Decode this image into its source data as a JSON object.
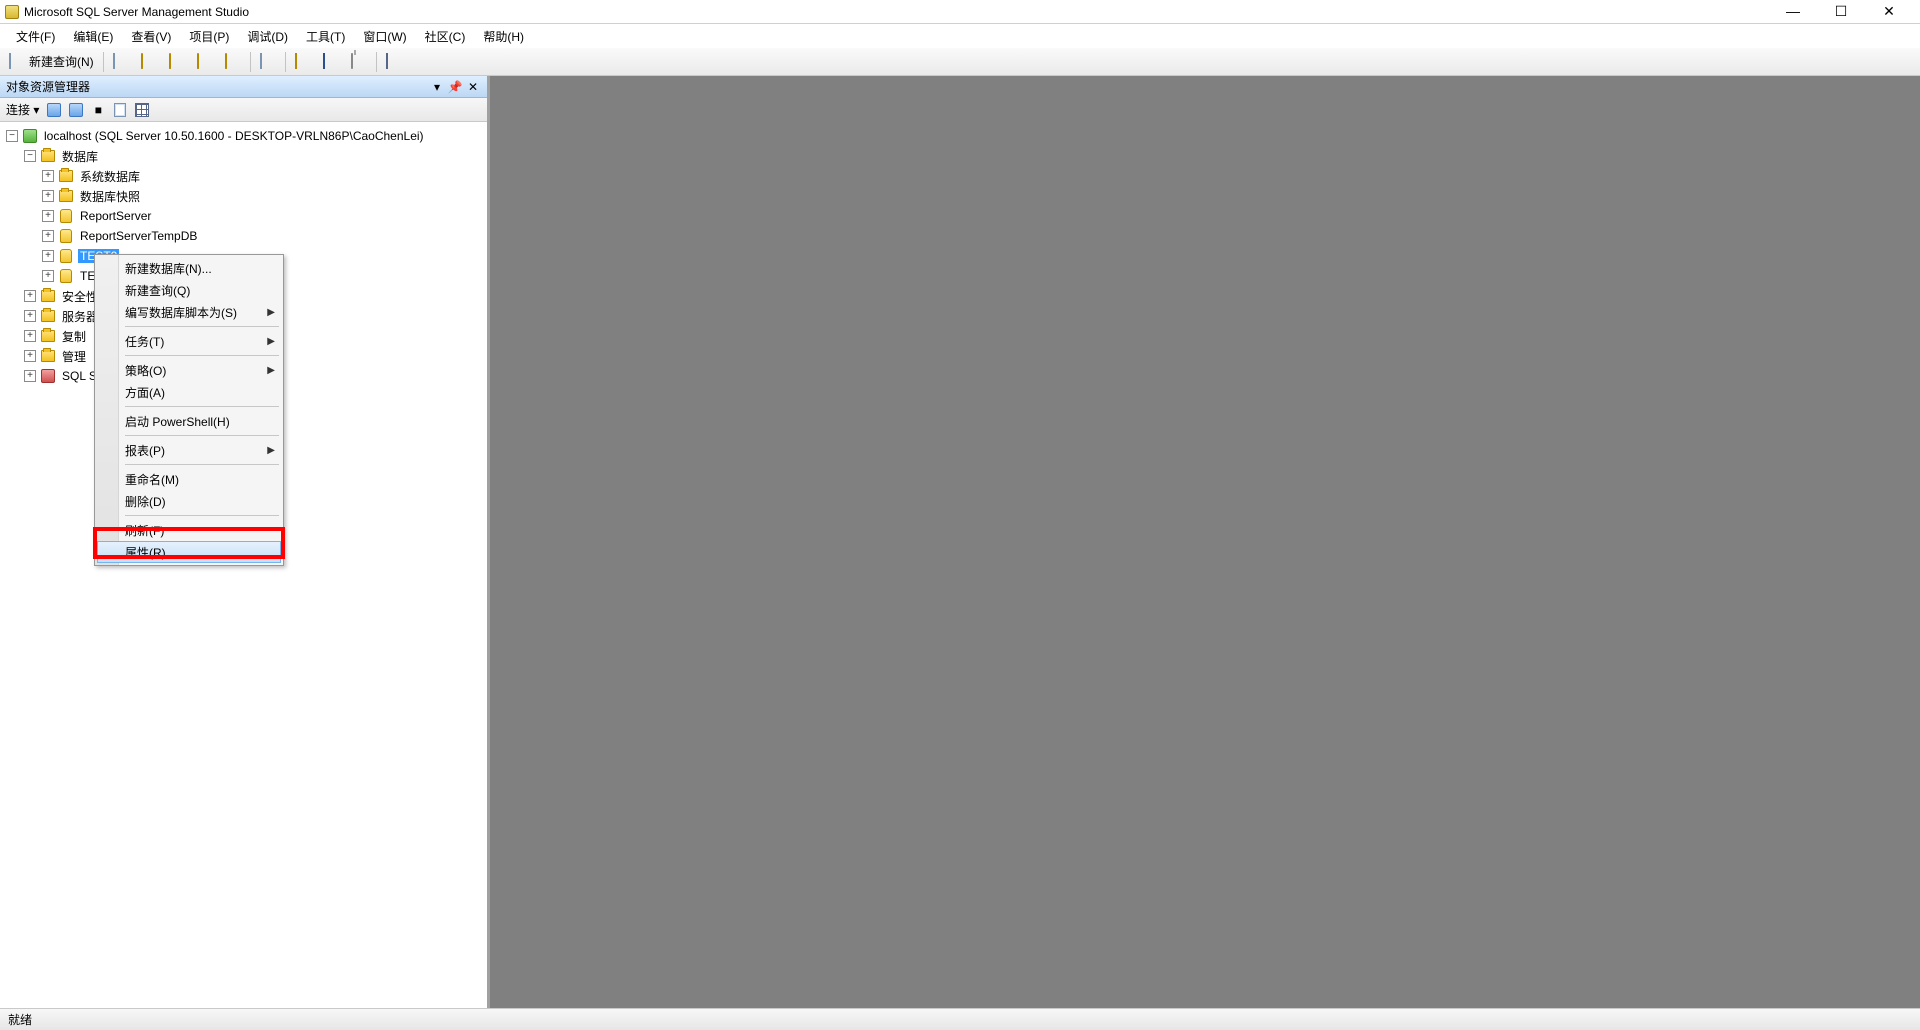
{
  "window": {
    "title": "Microsoft SQL Server Management Studio"
  },
  "menubar": {
    "items": [
      "文件(F)",
      "编辑(E)",
      "查看(V)",
      "项目(P)",
      "调试(D)",
      "工具(T)",
      "窗口(W)",
      "社区(C)",
      "帮助(H)"
    ]
  },
  "toolbar": {
    "new_query": "新建查询(N)"
  },
  "object_explorer": {
    "title": "对象资源管理器",
    "connect_label": "连接 ▾"
  },
  "tree": {
    "server": "localhost (SQL Server 10.50.1600 - DESKTOP-VRLN86P\\CaoChenLei)",
    "databases": "数据库",
    "sys_db": "系统数据库",
    "db_snapshot": "数据库快照",
    "report_server": "ReportServer",
    "report_server_temp": "ReportServerTempDB",
    "test0": "TEST0",
    "test1_partial": "TE",
    "security": "安全性",
    "server_objects": "服务器",
    "replication": "复制",
    "management": "管理",
    "sql_agent": "SQL S"
  },
  "context_menu": {
    "new_database": "新建数据库(N)...",
    "new_query": "新建查询(Q)",
    "script_db_as": "编写数据库脚本为(S)",
    "tasks": "任务(T)",
    "policies": "策略(O)",
    "facets": "方面(A)",
    "start_powershell": "启动 PowerShell(H)",
    "reports": "报表(P)",
    "rename": "重命名(M)",
    "delete": "删除(D)",
    "refresh": "刷新(F)",
    "properties": "属性(R)"
  },
  "statusbar": {
    "text": "就绪"
  }
}
